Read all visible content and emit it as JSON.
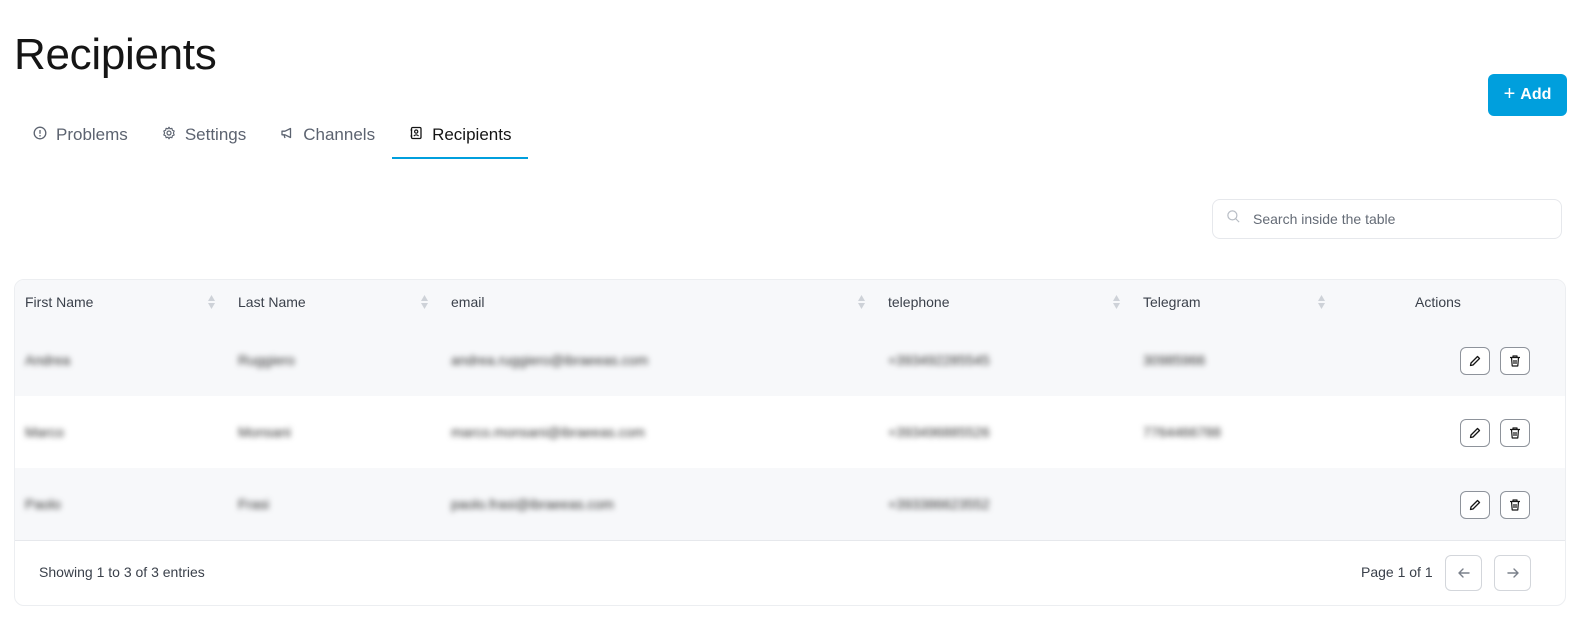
{
  "page": {
    "title": "Recipients"
  },
  "toolbar": {
    "add_label": "Add"
  },
  "tabs": [
    {
      "label": "Problems",
      "icon": "alert-circle-icon"
    },
    {
      "label": "Settings",
      "icon": "gear-icon"
    },
    {
      "label": "Channels",
      "icon": "megaphone-icon"
    },
    {
      "label": "Recipients",
      "icon": "contact-book-icon",
      "active": true
    }
  ],
  "search": {
    "placeholder": "Search inside the table",
    "value": ""
  },
  "table": {
    "columns": [
      "First Name",
      "Last Name",
      "email",
      "telephone",
      "Telegram",
      "Actions"
    ],
    "rows": [
      {
        "first_name": "Andrea",
        "last_name": "Ruggiero",
        "email": "andrea.ruggiero@ibraeeas.com",
        "telephone": "+393492285545",
        "telegram": "30985966"
      },
      {
        "first_name": "Marco",
        "last_name": "Monsani",
        "email": "marco.monsani@ibraeeas.com",
        "telephone": "+393496885526",
        "telegram": "7764466788"
      },
      {
        "first_name": "Paolo",
        "last_name": "Frasi",
        "email": "paolo.frasi@ibraeeas.com",
        "telephone": "+393386623552",
        "telegram": ""
      }
    ],
    "footer": {
      "showing": "Showing 1 to 3 of 3 entries",
      "page_info": "Page 1 of 1"
    }
  },
  "colors": {
    "accent": "#009fdd",
    "header_bg": "#f7f8fa"
  }
}
